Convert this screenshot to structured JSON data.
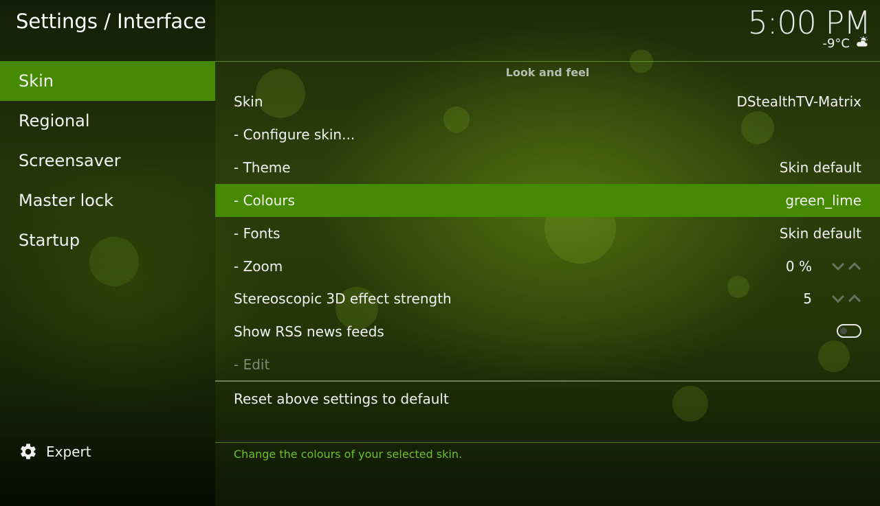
{
  "header": {
    "title": "Settings / Interface",
    "time": "5:00 PM",
    "temperature": "-9°C",
    "weather_icon": "cloud-sun-icon"
  },
  "sidebar": {
    "items": [
      {
        "label": "Skin",
        "active": true
      },
      {
        "label": "Regional",
        "active": false
      },
      {
        "label": "Screensaver",
        "active": false
      },
      {
        "label": "Master lock",
        "active": false
      },
      {
        "label": "Startup",
        "active": false
      }
    ],
    "level_label": "Expert",
    "level_icon": "gear-icon"
  },
  "main": {
    "section_header": "Look and feel",
    "settings": [
      {
        "label": "Skin",
        "value": "DStealthTV-Matrix"
      },
      {
        "label": "- Configure skin...",
        "value": ""
      },
      {
        "label": "- Theme",
        "value": "Skin default"
      },
      {
        "label": "- Colours",
        "value": "green_lime",
        "focused": true
      },
      {
        "label": "- Fonts",
        "value": "Skin default"
      },
      {
        "label": "- Zoom",
        "value": "0 %",
        "control": "spinner"
      },
      {
        "label": "Stereoscopic 3D effect strength",
        "value": "5",
        "control": "spinner"
      },
      {
        "label": "Show RSS news feeds",
        "control": "toggle",
        "enabled": false
      },
      {
        "label": "- Edit",
        "disabled": true
      }
    ],
    "reset_label": "Reset above settings to default",
    "help_text": "Change the colours of your selected skin."
  },
  "colors": {
    "accent": "#458a00",
    "help_text": "#6cc02a",
    "disabled_text": "#7f8a76"
  }
}
